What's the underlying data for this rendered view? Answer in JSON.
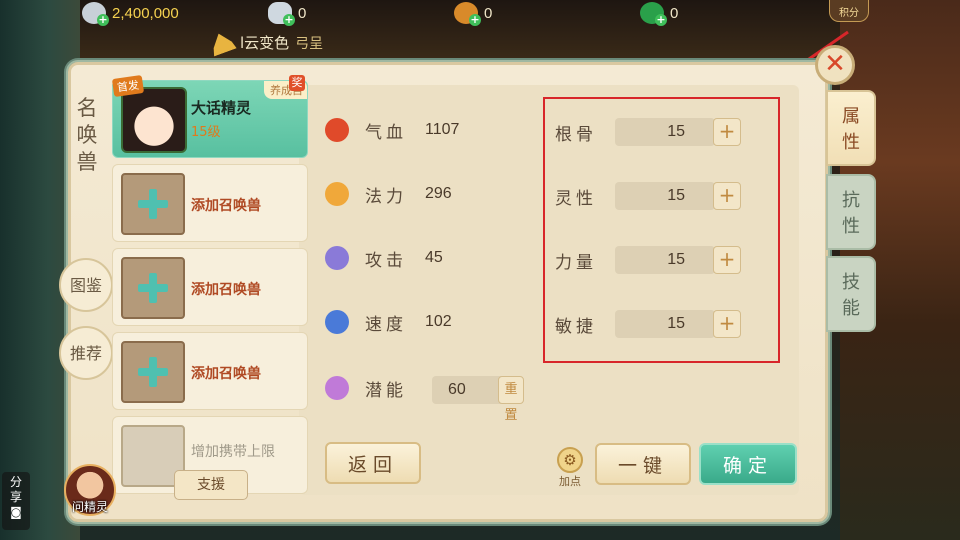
{
  "currency": [
    {
      "icon": "silver-coin-icon",
      "value": "2,400,000",
      "color": "gold"
    },
    {
      "icon": "ingot-icon",
      "value": "0",
      "color": "white"
    },
    {
      "icon": "copper-coin-icon",
      "value": "0",
      "color": "white"
    },
    {
      "icon": "jade-icon",
      "value": "0",
      "color": "white"
    }
  ],
  "score_badge": "积分",
  "chat": {
    "text": "l云变色",
    "emoji": "弓呈"
  },
  "panel": {
    "title": "名唤兽",
    "side_buttons": {
      "gallery": "图鉴",
      "recommend": "推荐"
    },
    "pets": [
      {
        "name": "大话精灵",
        "level": "15级",
        "tag": "首发",
        "foster": "养成目",
        "reward": "奖"
      },
      {
        "add_label": "添加召唤兽"
      },
      {
        "add_label": "添加召唤兽"
      },
      {
        "add_label": "添加召唤兽"
      },
      {
        "add_label": "增加携带上限"
      }
    ],
    "assist_label": "支援",
    "stats": [
      {
        "label": "气血",
        "value": "1107",
        "icon": "blood-drop-icon"
      },
      {
        "label": "法力",
        "value": "296",
        "icon": "mana-swirl-icon"
      },
      {
        "label": "攻击",
        "value": "45",
        "icon": "sword-icon"
      },
      {
        "label": "速度",
        "value": "102",
        "icon": "boot-icon"
      },
      {
        "label": "潜能",
        "value": "60",
        "icon": "potential-flame-icon"
      }
    ],
    "attributes": [
      {
        "label": "根骨",
        "value": "15"
      },
      {
        "label": "灵性",
        "value": "15"
      },
      {
        "label": "力量",
        "value": "15"
      },
      {
        "label": "敏捷",
        "value": "15"
      }
    ],
    "reset_label": "重置",
    "buttons": {
      "back": "返回",
      "add_points": "加点",
      "one_key": "一键",
      "confirm": "确定"
    },
    "tabs": [
      "属性",
      "抗性",
      "技能"
    ]
  },
  "ask_sprite": "问精灵",
  "share": "分享"
}
